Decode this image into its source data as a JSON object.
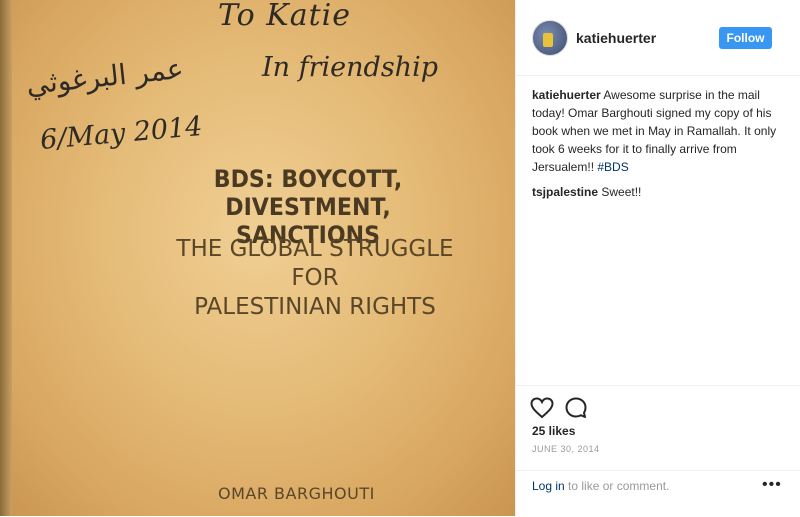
{
  "photo": {
    "handwriting_to": "To Katie",
    "handwriting_friendship": "In friendship",
    "handwriting_signature": "عمر البرغوثي",
    "handwriting_date": "6/May 2014",
    "book_title_line1": "BDS: BOYCOTT,",
    "book_title_line2": "DIVESTMENT, SANCTIONS",
    "book_subtitle_line1": "THE GLOBAL STRUGGLE FOR",
    "book_subtitle_line2": "PALESTINIAN RIGHTS",
    "book_author": "OMAR BARGHOUTI"
  },
  "header": {
    "username": "katiehuerter",
    "follow_label": "Follow"
  },
  "comments": [
    {
      "user": "katiehuerter",
      "text": "Awesome surprise in the mail today! Omar Barghouti signed my copy of his book when we met in May in Ramallah. It only took 6 weeks for it to finally arrive from Jersualem!!",
      "tag": "#BDS"
    },
    {
      "user": "tsjpalestine",
      "text": "Sweet!!"
    }
  ],
  "actions": {
    "likes": "25 likes",
    "date": "JUNE 30, 2014"
  },
  "footer": {
    "login_link": "Log in",
    "login_text": "to like or comment.",
    "more": "•••"
  },
  "colors": {
    "follow_bg": "#3897f0",
    "hashtag": "#003569",
    "muted": "#999999"
  }
}
